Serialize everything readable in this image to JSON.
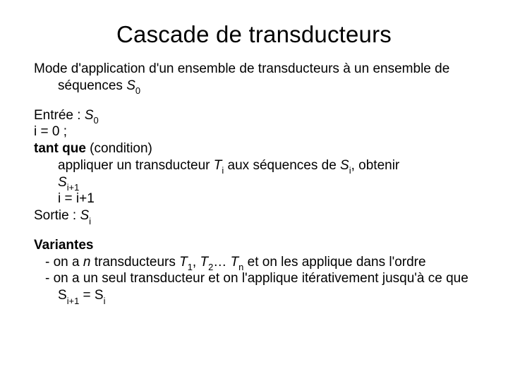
{
  "title": "Cascade de transducteurs",
  "intro_main": "Mode d'application d'un ensemble de transducteurs à un",
  "intro_cont": "ensemble de séquences ",
  "S_sym": "S",
  "zero": "0",
  "entree_label": "Entrée : ",
  "i_init": "i = 0 ;",
  "tantque": "tant que",
  "cond": " (condition)",
  "apply1a": "appliquer un transducteur",
  "T_sym": "T",
  "i_sub": "i",
  "apply1b": " aux séquences de ",
  "apply1c": ", obtenir",
  "ip1": "i+1",
  "i_incr": "i = i+1",
  "sortie_label": "Sortie : ",
  "variantes": "Variantes",
  "var1a": "- on a ",
  "n_sym": "n",
  "var1b": " transducteurs ",
  "one": "1",
  "two": "2",
  "ellipsis": "… ",
  "var1c": " et on les applique dans",
  "var1d": "l'ordre",
  "var2a": "- on a un seul transducteur et on l'applique itérativement",
  "var2b": "jusqu'à ce que S",
  "eq": " = S"
}
